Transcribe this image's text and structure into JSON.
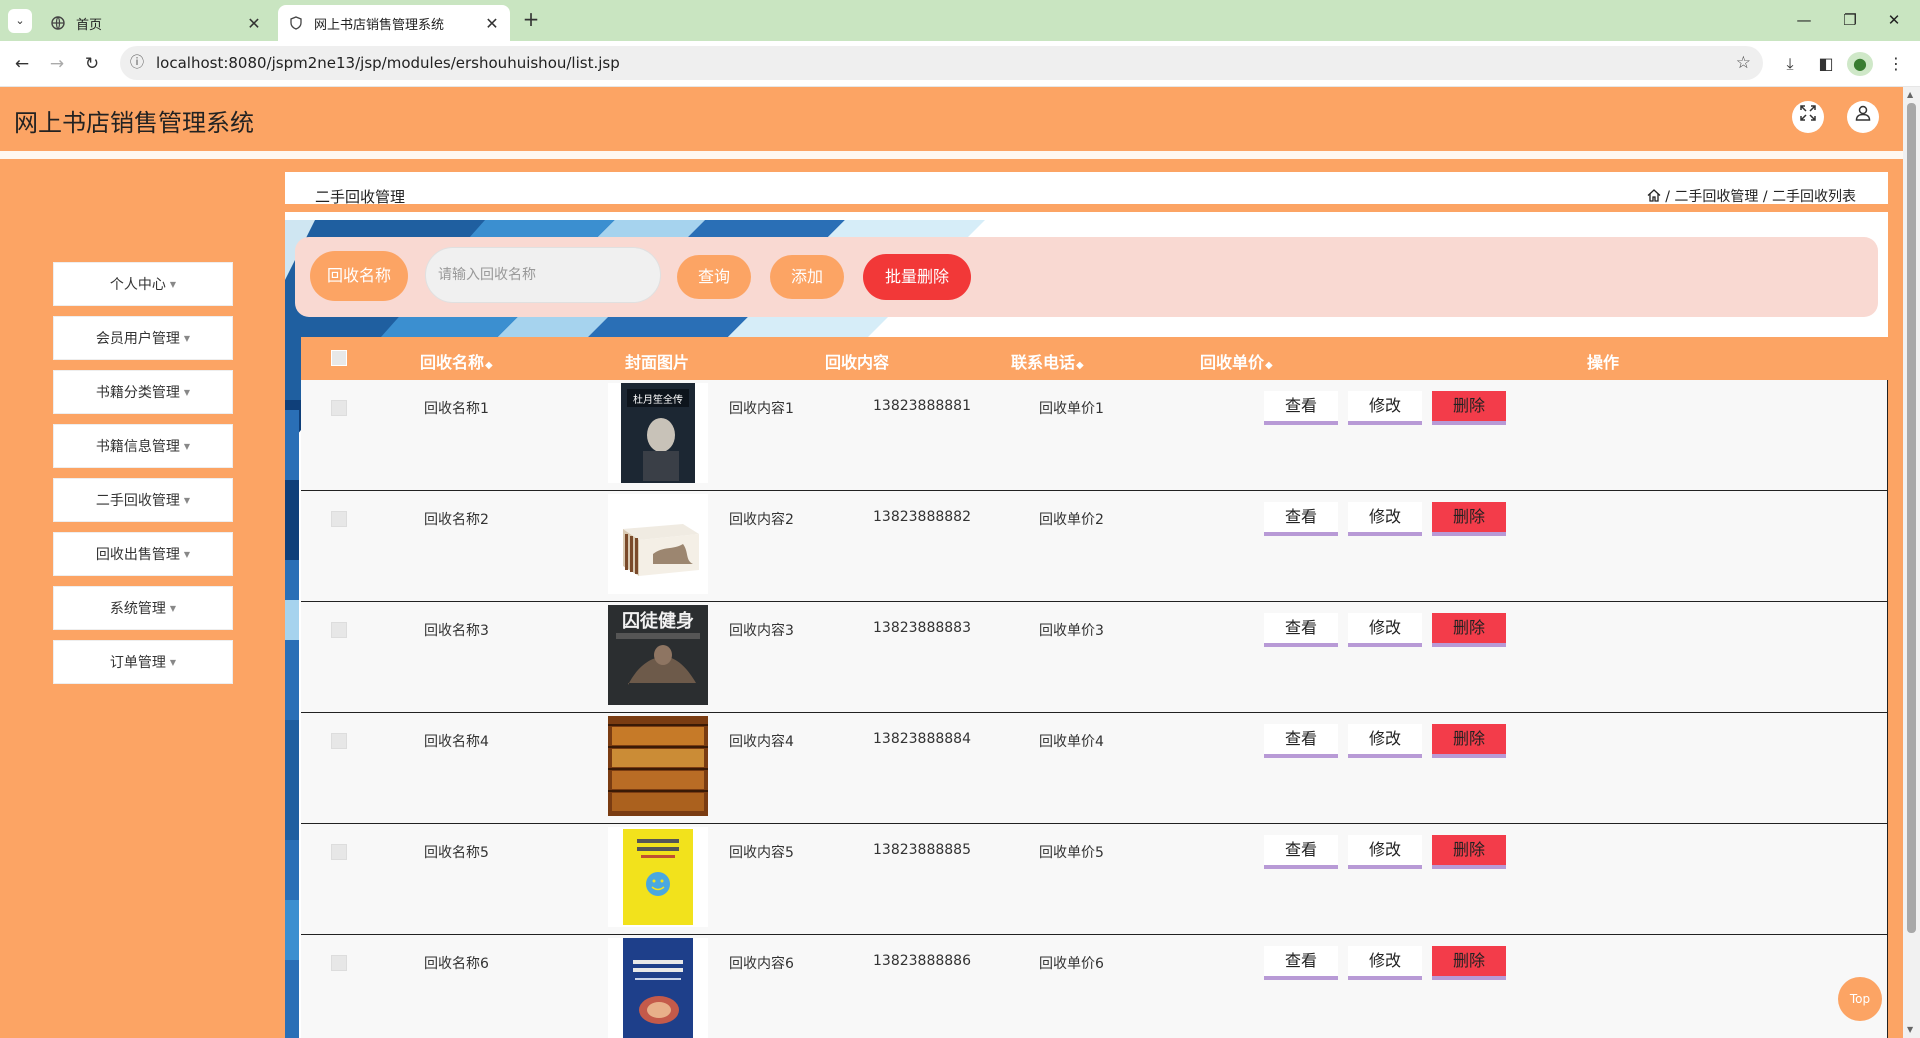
{
  "browser": {
    "tabs": [
      {
        "title": "首页",
        "active": false
      },
      {
        "title": "网上书店销售管理系统",
        "active": true
      }
    ],
    "url": "localhost:8080/jspm2ne13/jsp/modules/ershouhuishou/list.jsp"
  },
  "header": {
    "title": "网上书店销售管理系统",
    "icons": [
      "fullscreen-icon",
      "user-icon"
    ]
  },
  "sidebar": {
    "items": [
      {
        "label": "个人中心"
      },
      {
        "label": "会员用户管理"
      },
      {
        "label": "书籍分类管理"
      },
      {
        "label": "书籍信息管理"
      },
      {
        "label": "二手回收管理"
      },
      {
        "label": "回收出售管理"
      },
      {
        "label": "系统管理"
      },
      {
        "label": "订单管理"
      }
    ]
  },
  "breadcrumb": {
    "title": "二手回收管理",
    "path": "/ 二手回收管理 / 二手回收列表"
  },
  "search": {
    "label": "回收名称",
    "placeholder": "请输入回收名称",
    "query_label": "查询",
    "add_label": "添加",
    "batch_delete_label": "批量删除"
  },
  "table": {
    "columns": [
      "回收名称",
      "封面图片",
      "回收内容",
      "联系电话",
      "回收单价",
      "操作"
    ],
    "actions": {
      "view": "查看",
      "edit": "修改",
      "delete": "删除"
    },
    "rows": [
      {
        "name": "回收名称1",
        "content": "回收内容1",
        "phone": "13823888881",
        "price": "回收单价1",
        "cover_title": "杜月笙全传"
      },
      {
        "name": "回收名称2",
        "content": "回收内容2",
        "phone": "13823888882",
        "price": "回收单价2",
        "cover_title": ""
      },
      {
        "name": "回收名称3",
        "content": "回收内容3",
        "phone": "13823888883",
        "price": "回收单价3",
        "cover_title": "囚徒健身"
      },
      {
        "name": "回收名称4",
        "content": "回收内容4",
        "phone": "13823888884",
        "price": "回收单价4",
        "cover_title": ""
      },
      {
        "name": "回收名称5",
        "content": "回收内容5",
        "phone": "13823888885",
        "price": "回收单价5",
        "cover_title": ""
      },
      {
        "name": "回收名称6",
        "content": "回收内容6",
        "phone": "13823888886",
        "price": "回收单价6",
        "cover_title": ""
      }
    ]
  },
  "to_top_label": "Top",
  "colors": {
    "accent": "#fca464",
    "danger": "#f23838"
  }
}
